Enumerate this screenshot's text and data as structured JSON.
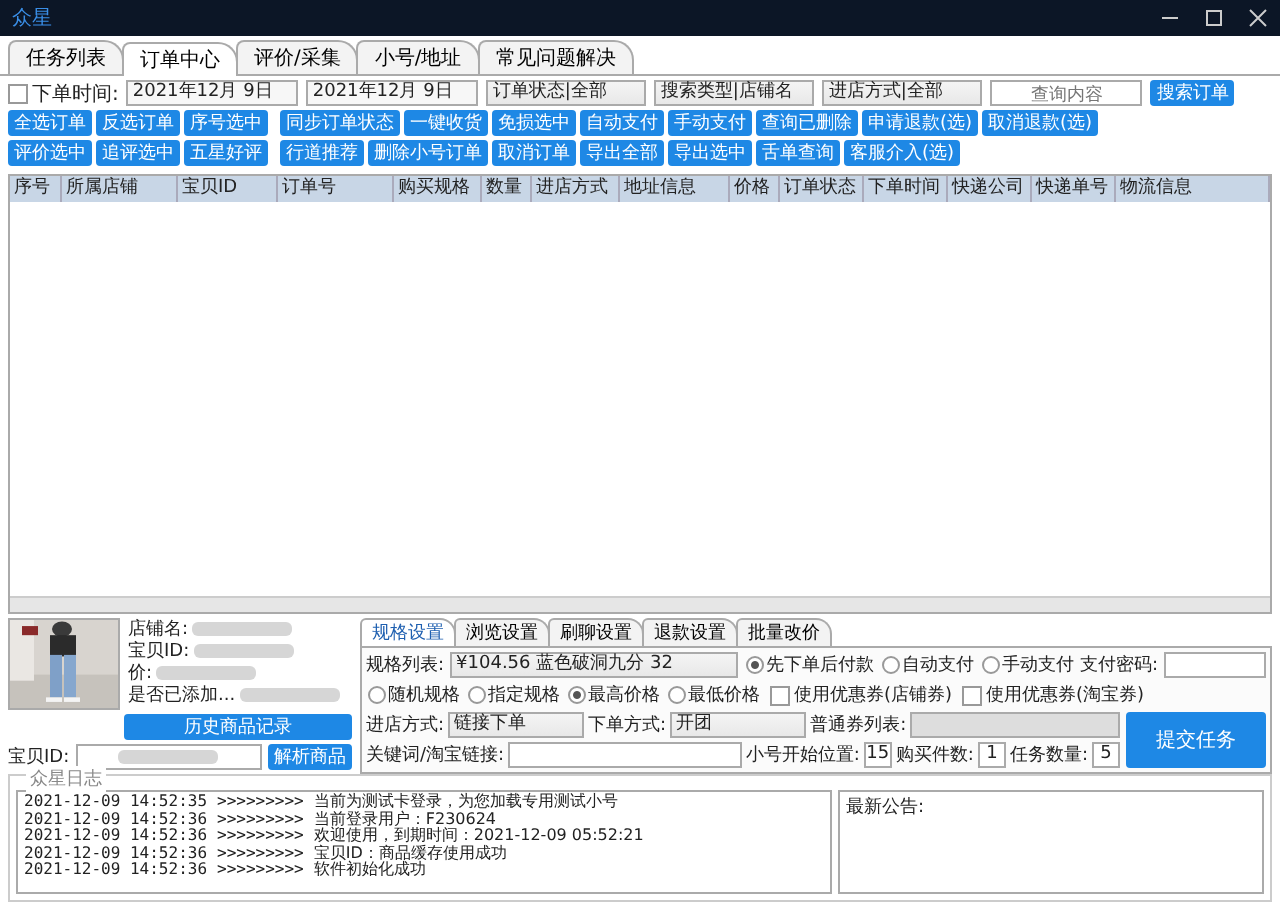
{
  "window": {
    "title": "众星"
  },
  "tabs": [
    {
      "label": "任务列表",
      "selected": false
    },
    {
      "label": "订单中心",
      "selected": true
    },
    {
      "label": "评价/采集",
      "selected": false
    },
    {
      "label": "小号/地址",
      "selected": false
    },
    {
      "label": "常见问题解决",
      "selected": false
    }
  ],
  "filters": {
    "time_checkbox": {
      "label": "下单时间:",
      "checked": false
    },
    "date_from": "2021年12月 9日",
    "date_to": "2021年12月 9日",
    "order_status": "订单状态|全部",
    "search_type": "搜索类型|店铺名",
    "entry_mode": "进店方式|全部",
    "query": {
      "placeholder": "查询内容"
    },
    "search_button": "搜索订单"
  },
  "button_rows": [
    [
      [
        "全选订单",
        "反选订单",
        "序号选中"
      ],
      [
        "同步订单状态",
        "一键收货",
        "免损选中",
        "自动支付",
        "手动支付",
        "查询已删除",
        "申请退款(选)",
        "取消退款(选)"
      ]
    ],
    [
      [
        "评价选中",
        "追评选中",
        "五星好评"
      ],
      [
        "行道推荐",
        "删除小号订单",
        "取消订单",
        "导出全部",
        "导出选中",
        "舌单查询",
        "客服介入(选)"
      ]
    ]
  ],
  "table": {
    "columns": [
      "序号",
      "所属店铺",
      "宝贝ID",
      "订单号",
      "购买规格",
      "数量",
      "进店方式",
      "地址信息",
      "价格",
      "订单状态",
      "下单时间",
      "快递公司",
      "快递单号",
      "物流信息"
    ]
  },
  "product": {
    "image": {
      "kind": "picture"
    },
    "labels": [
      "店铺名:",
      "宝贝ID:",
      "价:",
      "是否已添加..."
    ],
    "history_button": "历史商品记录",
    "id_label": "宝贝ID:",
    "parse_button": "解析商品"
  },
  "settings": {
    "tabs": [
      {
        "label": "规格设置",
        "selected": true
      },
      {
        "label": "浏览设置",
        "selected": false
      },
      {
        "label": "刷聊设置",
        "selected": false
      },
      {
        "label": "退款设置",
        "selected": false
      },
      {
        "label": "批量改价",
        "selected": false
      }
    ],
    "spec_label": "规格列表:",
    "spec_value": "¥104.56  蓝色破洞九分 32",
    "pay_modes": [
      {
        "label": "先下单后付款",
        "selected": true
      },
      {
        "label": "自动支付",
        "selected": false
      },
      {
        "label": "手动支付",
        "selected": false
      }
    ],
    "pay_password_label": "支付密码:",
    "spec_modes": [
      {
        "label": "随机规格",
        "selected": false
      },
      {
        "label": "指定规格",
        "selected": false
      },
      {
        "label": "最高价格",
        "selected": true
      },
      {
        "label": "最低价格",
        "selected": false
      }
    ],
    "coupons": [
      {
        "label": "使用优惠券(店铺券)",
        "checked": false
      },
      {
        "label": "使用优惠券(淘宝券)",
        "checked": false
      }
    ],
    "entry_label": "进店方式:",
    "entry_value": "链接下单",
    "order_label": "下单方式:",
    "order_value": "开团",
    "coupon_list_label": "普通券列表:",
    "keyword_label": "关键词/淘宝链接:",
    "start_label": "小号开始位置:",
    "start_value": "15",
    "qty_label": "购买件数:",
    "qty_value": "1",
    "count_label": "任务数量:",
    "count_value": "5",
    "submit_button": "提交任务"
  },
  "log": {
    "title": "众星日志",
    "lines": [
      {
        "time": "2021-12-09 14:52:35",
        "arrow": ">>>>>>>>>",
        "text": "当前为测试卡登录，为您加载专用测试小号"
      },
      {
        "time": "2021-12-09 14:52:36",
        "arrow": ">>>>>>>>>",
        "text": "当前登录用户：F230624"
      },
      {
        "time": "2021-12-09 14:52:36",
        "arrow": ">>>>>>>>>",
        "text": "欢迎使用，到期时间：2021-12-09 05:52:21"
      },
      {
        "time": "2021-12-09 14:52:36",
        "arrow": ">>>>>>>>>",
        "text": "宝贝ID：商品缓存使用成功"
      },
      {
        "time": "2021-12-09 14:52:36",
        "arrow": ">>>>>>>>>",
        "text": "软件初始化成功"
      }
    ],
    "notice_label": "最新公告:"
  }
}
